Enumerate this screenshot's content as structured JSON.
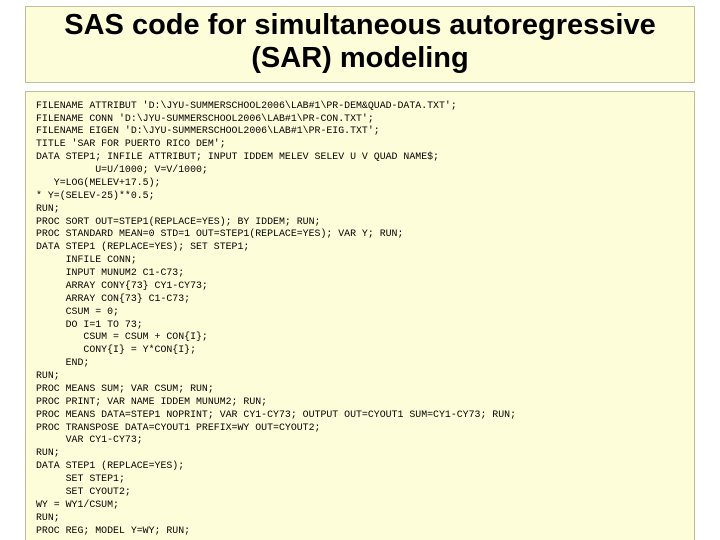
{
  "title_line1": "SAS code for simultaneous autoregressive",
  "title_line2": "(SAR)  modeling",
  "code": "FILENAME ATTRIBUT 'D:\\JYU-SUMMERSCHOOL2006\\LAB#1\\PR-DEM&QUAD-DATA.TXT';\nFILENAME CONN 'D:\\JYU-SUMMERSCHOOL2006\\LAB#1\\PR-CON.TXT';\nFILENAME EIGEN 'D:\\JYU-SUMMERSCHOOL2006\\LAB#1\\PR-EIG.TXT';\nTITLE 'SAR FOR PUERTO RICO DEM';\nDATA STEP1; INFILE ATTRIBUT; INPUT IDDEM MELEV SELEV U V QUAD NAME$;\n          U=U/1000; V=V/1000;\n   Y=LOG(MELEV+17.5);\n* Y=(SELEV-25)**0.5;\nRUN;\nPROC SORT OUT=STEP1(REPLACE=YES); BY IDDEM; RUN;\nPROC STANDARD MEAN=0 STD=1 OUT=STEP1(REPLACE=YES); VAR Y; RUN;\nDATA STEP1 (REPLACE=YES); SET STEP1;\n     INFILE CONN;\n     INPUT MUNUM2 C1-C73;\n     ARRAY CONY{73} CY1-CY73;\n     ARRAY CON{73} C1-C73;\n     CSUM = 0;\n     DO I=1 TO 73;\n        CSUM = CSUM + CON{I};\n        CONY{I} = Y*CON{I};\n     END;\nRUN;\nPROC MEANS SUM; VAR CSUM; RUN;\nPROC PRINT; VAR NAME IDDEM MUNUM2; RUN;\nPROC MEANS DATA=STEP1 NOPRINT; VAR CY1-CY73; OUTPUT OUT=CYOUT1 SUM=CY1-CY73; RUN;\nPROC TRANSPOSE DATA=CYOUT1 PREFIX=WY OUT=CYOUT2;\n     VAR CY1-CY73;\nRUN;\nDATA STEP1 (REPLACE=YES);\n     SET STEP1;\n     SET CYOUT2;\nWY = WY1/CSUM;\nRUN;\nPROC REG; MODEL Y=WY; RUN;"
}
